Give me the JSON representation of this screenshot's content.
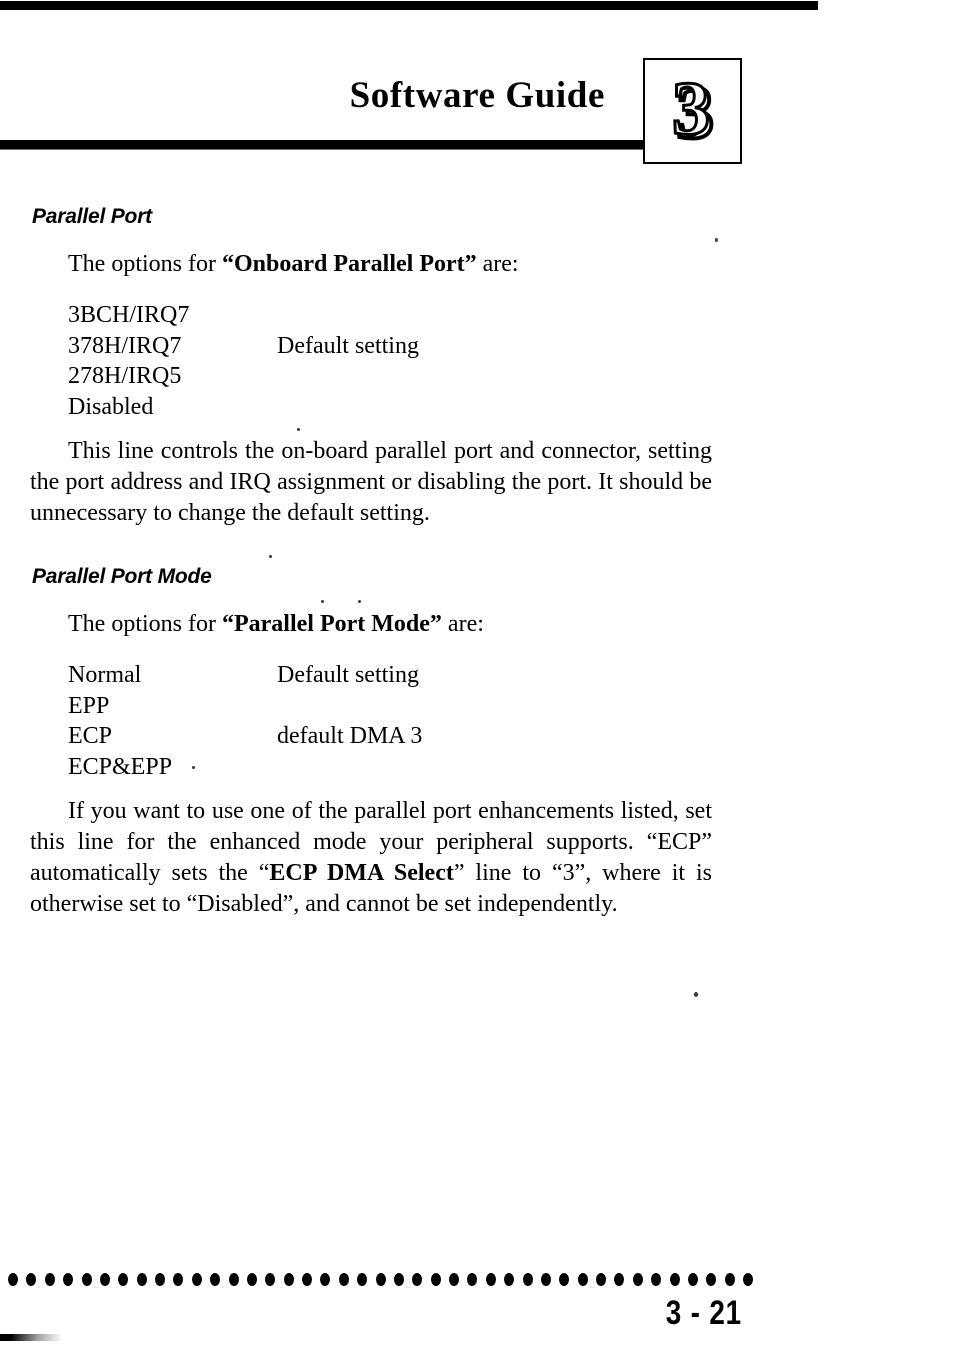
{
  "page": {
    "header": {
      "title": "Software Guide",
      "chapter_number": "3"
    },
    "footer": {
      "page_number": "3 - 21",
      "dot_count": 41
    },
    "sections": [
      {
        "heading": "Parallel Port",
        "lead_prefix": "The options for ",
        "lead_quoted": "“Onboard Parallel Port”",
        "lead_suffix": " are:",
        "options": [
          {
            "name": "3BCH/IRQ7",
            "note": ""
          },
          {
            "name": "378H/IRQ7",
            "note": "Default setting"
          },
          {
            "name": "278H/IRQ5",
            "note": ""
          },
          {
            "name": "Disabled",
            "note": ""
          }
        ],
        "paragraph": "This line controls the on-board parallel port and connector, setting the port address and IRQ assignment or disabling the port. It should be unnecessary to change the default setting."
      },
      {
        "heading": "Parallel Port Mode",
        "lead_prefix": "The options for ",
        "lead_quoted": "“Parallel Port Mode”",
        "lead_suffix": " are:",
        "options": [
          {
            "name": "Normal",
            "note": "Default setting"
          },
          {
            "name": "EPP",
            "note": ""
          },
          {
            "name": "ECP",
            "note": "default DMA 3"
          },
          {
            "name": "ECP&EPP",
            "note": ""
          }
        ],
        "paragraph_parts": {
          "p1": "If you want to use one of the parallel port enhancements listed, set this line for the enhanced mode your peripheral supports. “ECP” automatically sets the “",
          "p2_bold": "ECP DMA Select",
          "p3": "” line to “3”, where it is otherwise set to “Disabled”, and cannot be set independently."
        }
      }
    ]
  }
}
